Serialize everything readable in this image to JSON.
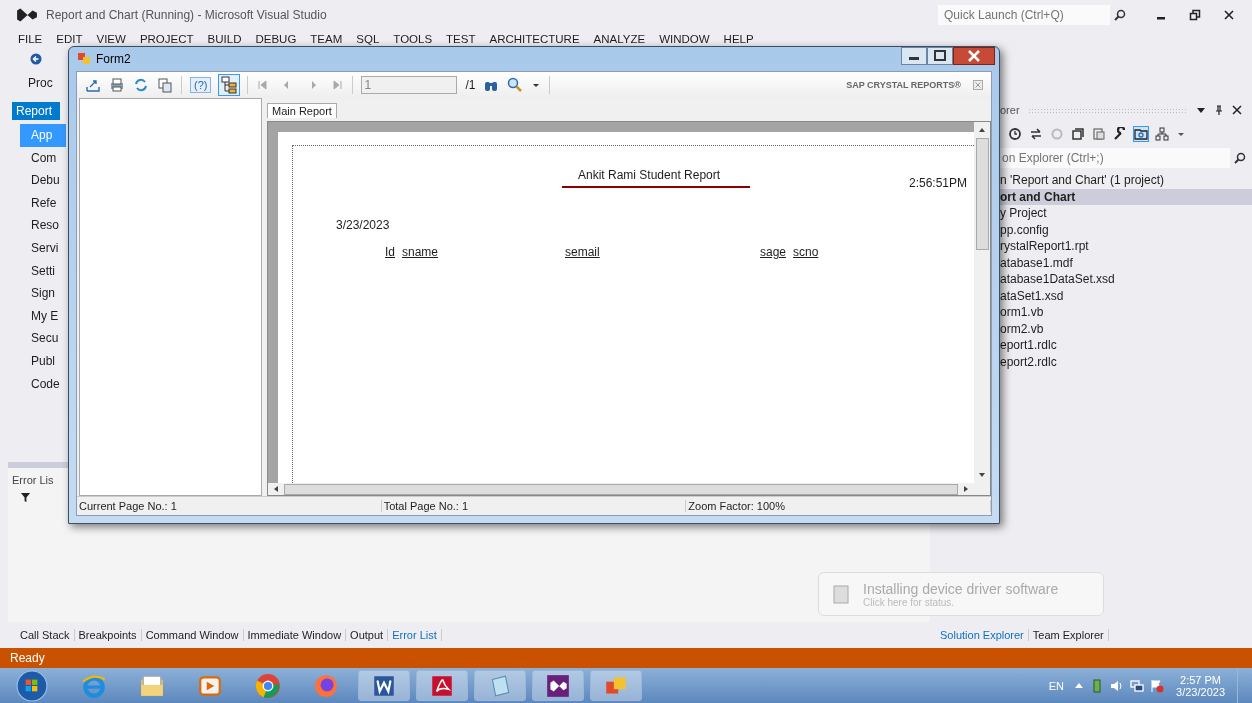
{
  "vs_window": {
    "title": "Report and Chart (Running) - Microsoft Visual Studio",
    "quick_launch": {
      "placeholder": "Quick Launch (Ctrl+Q)"
    },
    "menu": [
      "FILE",
      "EDIT",
      "VIEW",
      "PROJECT",
      "BUILD",
      "DEBUG",
      "TEAM",
      "SQL",
      "TOOLS",
      "TEST",
      "ARCHITECTURE",
      "ANALYZE",
      "WINDOW",
      "HELP"
    ],
    "toolbar_label": "Proc"
  },
  "left_panel": {
    "header": "Report",
    "items": [
      {
        "label": "App",
        "selected": true
      },
      {
        "label": "Com",
        "selected": false
      },
      {
        "label": "Debu",
        "selected": false
      },
      {
        "label": "Refe",
        "selected": false
      },
      {
        "label": "Reso",
        "selected": false
      },
      {
        "label": "Servi",
        "selected": false
      },
      {
        "label": "Setti",
        "selected": false
      },
      {
        "label": "Sign",
        "selected": false
      },
      {
        "label": "My E",
        "selected": false
      },
      {
        "label": "Secu",
        "selected": false
      },
      {
        "label": "Publ",
        "selected": false
      },
      {
        "label": "Code",
        "selected": false
      }
    ]
  },
  "error_list": {
    "title": "Error Lis"
  },
  "form2": {
    "title": "Form2",
    "toolbar": {
      "help_label": "(?)",
      "tree_on": true,
      "page_input": "1",
      "page_total": "/1",
      "brand": "SAP CRYSTAL REPORTS®"
    },
    "tabs": [
      {
        "label": "Main Report",
        "selected": true
      }
    ],
    "report": {
      "title": "Ankit Rami Student Report",
      "time": "2:56:51PM",
      "date": "3/23/2023",
      "columns": [
        "Id",
        "sname",
        "semail",
        "sage",
        "scno"
      ]
    },
    "status": [
      "Current Page No.: 1",
      "Total Page No.: 1",
      "Zoom Factor: 100%"
    ]
  },
  "solution_explorer": {
    "header": "orer",
    "search": {
      "placeholder": "on Explorer (Ctrl+;)"
    },
    "items": [
      {
        "label": "n 'Report and Chart' (1 project)",
        "kind": "solution",
        "selected": false
      },
      {
        "label": "ort and Chart",
        "kind": "project",
        "selected": true
      },
      {
        "label": "y Project",
        "kind": "file",
        "selected": false
      },
      {
        "label": "pp.config",
        "kind": "file",
        "selected": false
      },
      {
        "label": "rystalReport1.rpt",
        "kind": "file",
        "selected": false
      },
      {
        "label": "atabase1.mdf",
        "kind": "file",
        "selected": false
      },
      {
        "label": "atabase1DataSet.xsd",
        "kind": "file",
        "selected": false
      },
      {
        "label": "ataSet1.xsd",
        "kind": "file",
        "selected": false
      },
      {
        "label": "orm1.vb",
        "kind": "file",
        "selected": false
      },
      {
        "label": "orm2.vb",
        "kind": "file",
        "selected": false
      },
      {
        "label": "eport1.rdlc",
        "kind": "file",
        "selected": false
      },
      {
        "label": "eport2.rdlc",
        "kind": "file",
        "selected": false
      }
    ]
  },
  "bottom_tabs": [
    {
      "label": "Call Stack",
      "selected": false
    },
    {
      "label": "Breakpoints",
      "selected": false
    },
    {
      "label": "Command Window",
      "selected": false
    },
    {
      "label": "Immediate Window",
      "selected": false
    },
    {
      "label": "Output",
      "selected": false
    },
    {
      "label": "Error List",
      "selected": true
    }
  ],
  "right_tabs": [
    {
      "label": "Solution Explorer",
      "selected": true
    },
    {
      "label": "Team Explorer",
      "selected": false
    }
  ],
  "notification": {
    "title": "Installing device driver software",
    "subtitle": "Click here for status."
  },
  "status_bar": "Ready",
  "taskbar": {
    "language": "EN",
    "time": "2:57 PM",
    "date": "3/23/2023"
  }
}
